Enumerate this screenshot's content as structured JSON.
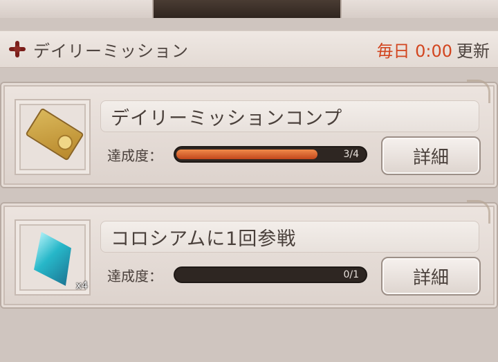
{
  "header": {
    "title": "デイリーミッション",
    "reset_time": "毎日 0:00",
    "reset_label": "更新"
  },
  "missions": [
    {
      "title": "デイリーミッションコンプ",
      "progress_label": "達成度：",
      "progress_text": "3/4",
      "progress_fraction": 0.75,
      "detail_label": "詳細",
      "icon": "ticket-icon"
    },
    {
      "title": "コロシアムに1回参戦",
      "progress_label": "達成度：",
      "progress_text": "0/1",
      "progress_fraction": 0.0,
      "detail_label": "詳細",
      "reward_quantity": "x4",
      "icon": "crystal-icon"
    }
  ],
  "colors": {
    "accent": "#d2451f",
    "progress_fill": "#c2471c",
    "icon_accent": "#7a1e1a"
  }
}
